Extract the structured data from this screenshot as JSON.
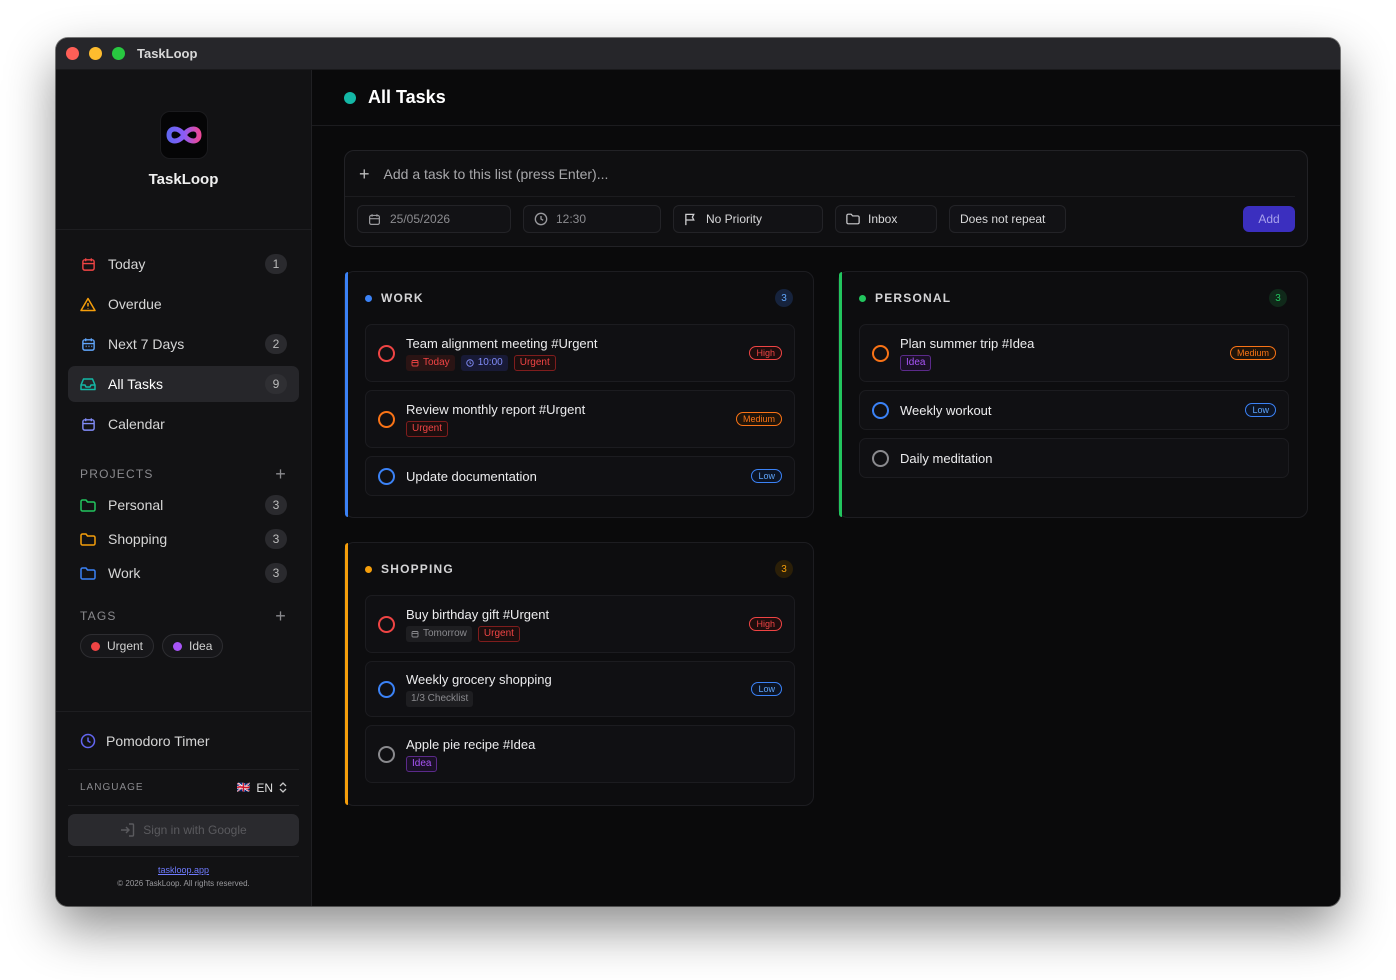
{
  "window": {
    "title": "TaskLoop"
  },
  "brand": {
    "name": "TaskLoop"
  },
  "nav": [
    {
      "label": "Today",
      "count": "1",
      "color": "#ef4444"
    },
    {
      "label": "Overdue",
      "count": "",
      "color": "#f59e0b"
    },
    {
      "label": "Next 7 Days",
      "count": "2",
      "color": "#60a5fa"
    },
    {
      "label": "All Tasks",
      "count": "9",
      "color": "#14b8a6"
    },
    {
      "label": "Calendar",
      "count": "",
      "color": "#818cf8"
    }
  ],
  "projects": {
    "heading": "PROJECTS",
    "items": [
      {
        "label": "Personal",
        "count": "3",
        "color": "#22c55e"
      },
      {
        "label": "Shopping",
        "count": "3",
        "color": "#f59e0b"
      },
      {
        "label": "Work",
        "count": "3",
        "color": "#3b82f6"
      }
    ]
  },
  "tags": {
    "heading": "TAGS",
    "items": [
      {
        "label": "Urgent",
        "color": "#ef4444"
      },
      {
        "label": "Idea",
        "color": "#a855f7"
      }
    ]
  },
  "pomodoro": {
    "label": "Pomodoro Timer"
  },
  "language": {
    "label": "LANGUAGE",
    "flag": "🇬🇧",
    "value": "EN"
  },
  "signin": {
    "label": "Sign in with Google"
  },
  "footer": {
    "link": "taskloop.app",
    "copyright": "© 2026 TaskLoop. All rights reserved."
  },
  "header": {
    "title": "All Tasks"
  },
  "composer": {
    "placeholder": "Add a task to this list (press Enter)...",
    "date": "25/05/2026",
    "time": "12:30",
    "priority": "No Priority",
    "list": "Inbox",
    "repeat": "Does not repeat",
    "add": "Add"
  },
  "lists": {
    "work": {
      "name": "WORK",
      "count": "3",
      "color": "#3b82f6",
      "tasks": [
        {
          "title": "Team alignment meeting #Urgent",
          "priority": "High",
          "date": "Today",
          "time": "10:00",
          "tag": "Urgent"
        },
        {
          "title": "Review monthly report #Urgent",
          "priority": "Medium",
          "tag": "Urgent"
        },
        {
          "title": "Update documentation",
          "priority": "Low"
        }
      ]
    },
    "personal": {
      "name": "PERSONAL",
      "count": "3",
      "color": "#22c55e",
      "tasks": [
        {
          "title": "Plan summer trip #Idea",
          "priority": "Medium",
          "tag": "Idea"
        },
        {
          "title": "Weekly workout",
          "priority": "Low"
        },
        {
          "title": "Daily meditation",
          "priority": ""
        }
      ]
    },
    "shopping": {
      "name": "SHOPPING",
      "count": "3",
      "color": "#f59e0b",
      "tasks": [
        {
          "title": "Buy birthday gift #Urgent",
          "priority": "High",
          "date": "Tomorrow",
          "tag": "Urgent"
        },
        {
          "title": "Weekly grocery shopping",
          "priority": "Low",
          "checklist": "1/3 Checklist"
        },
        {
          "title": "Apple pie recipe #Idea",
          "priority": "",
          "tag": "Idea"
        }
      ]
    }
  }
}
